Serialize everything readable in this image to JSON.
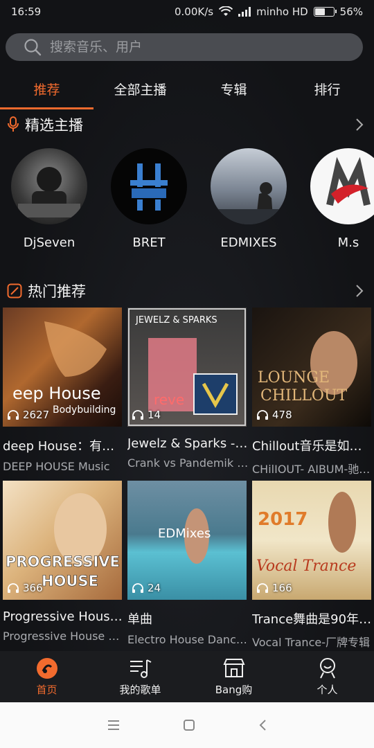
{
  "status_bar": {
    "time": "16:59",
    "network_speed": "0.00K/s",
    "carrier": "minho HD",
    "battery_percent": "56%",
    "battery_level": 0.56
  },
  "search": {
    "placeholder": "搜索音乐、用户"
  },
  "tabs": [
    {
      "label": "推荐",
      "active": true
    },
    {
      "label": "全部主播",
      "active": false
    },
    {
      "label": "专辑",
      "active": false
    },
    {
      "label": "排行",
      "active": false
    }
  ],
  "featured": {
    "title": "精选主播",
    "icon": "microphone-icon",
    "anchors": [
      {
        "name": "DjSeven"
      },
      {
        "name": "BRET"
      },
      {
        "name": "EDMIXES"
      },
      {
        "name": "M.s"
      }
    ]
  },
  "hot": {
    "title": "热门推荐",
    "icon": "edit-icon",
    "items": [
      {
        "plays": "2627",
        "title": "deep House：有…",
        "subtitle": "DEEP HOUSE Music"
      },
      {
        "plays": "14",
        "title": "Jewelz & Sparks - …",
        "subtitle": "Crank vs Pandemik (…"
      },
      {
        "plays": "478",
        "title": "Chillout音乐是如…",
        "subtitle": "CHilIOUT- AIBUM-驰…"
      },
      {
        "plays": "366",
        "title": "Progressive Hous…",
        "subtitle": "Progressive House M…"
      },
      {
        "plays": "24",
        "title": "单曲",
        "subtitle": "Electro House Dance…"
      },
      {
        "plays": "166",
        "title": "Trance舞曲是90年…",
        "subtitle": "Vocal Trance-厂牌专辑"
      }
    ]
  },
  "bottom_nav": [
    {
      "label": "首页",
      "icon": "home-disc-icon",
      "active": true
    },
    {
      "label": "我的歌单",
      "icon": "playlist-icon",
      "active": false
    },
    {
      "label": "Bang购",
      "icon": "shop-icon",
      "active": false
    },
    {
      "label": "个人",
      "icon": "profile-icon",
      "active": false
    }
  ],
  "colors": {
    "accent": "#f26b2e",
    "background": "#141518",
    "nav_bg": "#1b1c1f"
  }
}
